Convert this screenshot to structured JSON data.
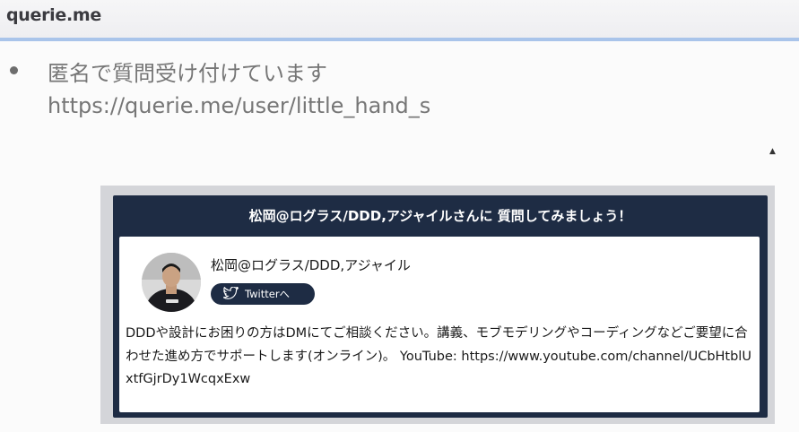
{
  "header": {
    "title": "querie.me"
  },
  "bullet": {
    "line1": "匿名で質問受け付けています",
    "line2": "https://querie.me/user/little_hand_s"
  },
  "card": {
    "header_text": "松岡@ログラス/DDD,アジャイルさんに 質問してみましょう！",
    "user_name": "松岡@ログラス/DDD,アジャイル",
    "twitter_label": "Twitterへ",
    "bio": "DDDや設計にお困りの方はDMにてご相談ください。講義、モブモデリングやコーディングなどご要望に合わせた進め方でサポートします(オンライン)。 YouTube: https://www.youtube.com/channel/UCbHtblUxtfGjrDy1WcqxExw"
  },
  "colors": {
    "accent_rule": "#a9c4ea",
    "card_navy": "#1e2c44",
    "bullet_text": "#767676"
  },
  "icons": [
    "twitter-bird-icon",
    "avatar-photo",
    "mouse-cursor-icon"
  ]
}
